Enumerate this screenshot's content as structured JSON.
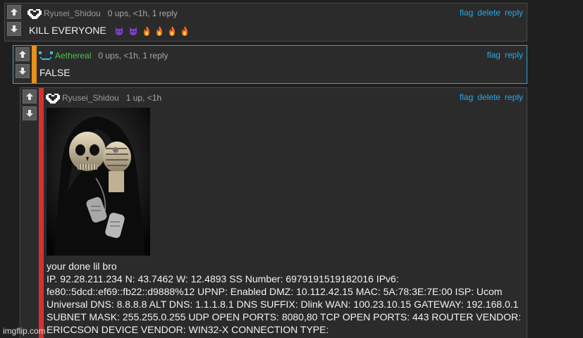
{
  "comments": [
    {
      "username": "Ryusei_Shidou",
      "meta": "0 ups, <1h, 1 reply",
      "text": "KILL EVERYONE",
      "actions": [
        "flag",
        "delete",
        "reply"
      ]
    },
    {
      "username": "Aethereal",
      "meta": "0 ups, <1h, 1 reply",
      "text": "FALSE",
      "actions": [
        "flag",
        "reply"
      ]
    },
    {
      "username": "Ryusei_Shidou",
      "meta": "1 up, <1h",
      "caption": "your done lil bro",
      "long_text": "IP. 92.28.211.234 N: 43.7462 W: 12.4893 SS Number: 6979191519182016 IPv6: fe80::5dcd::ef69::fb22::d9888%12 UPNP: Enabled DMZ: 10.112.42.15 MAC: 5A:78:3E:7E:00 ISP: Ucom Universal DNS: 8.8.8.8 ALT DNS: 1.1.1.8.1 DNS SUFFIX: Dlink WAN: 100.23.10.15 GATEWAY: 192.168.0.1 SUBNET MASK: 255.255.0.255 UDP OPEN PORTS: 8080,80 TCP OPEN PORTS: 443 ROUTER VENDOR: ERICCSON DEVICE VENDOR: WIN32-X CONNECTION TYPE:",
      "actions": [
        "flag",
        "delete",
        "reply"
      ]
    }
  ],
  "watermark": "imgflip.com",
  "colors": {
    "reply_stripe_orange": "#e8911c",
    "reply_stripe_red": "#d63131",
    "link": "#2aa7e8",
    "username_green": "#4fc14f",
    "username_gray": "#9a9a9a"
  },
  "icons": {
    "vote_up": "arrow-up-icon",
    "vote_down": "arrow-down-icon",
    "avatar": "pixel-heart-icon",
    "emoji_purple": "purple-devil-icon",
    "emoji_fire": "fire-icon"
  }
}
